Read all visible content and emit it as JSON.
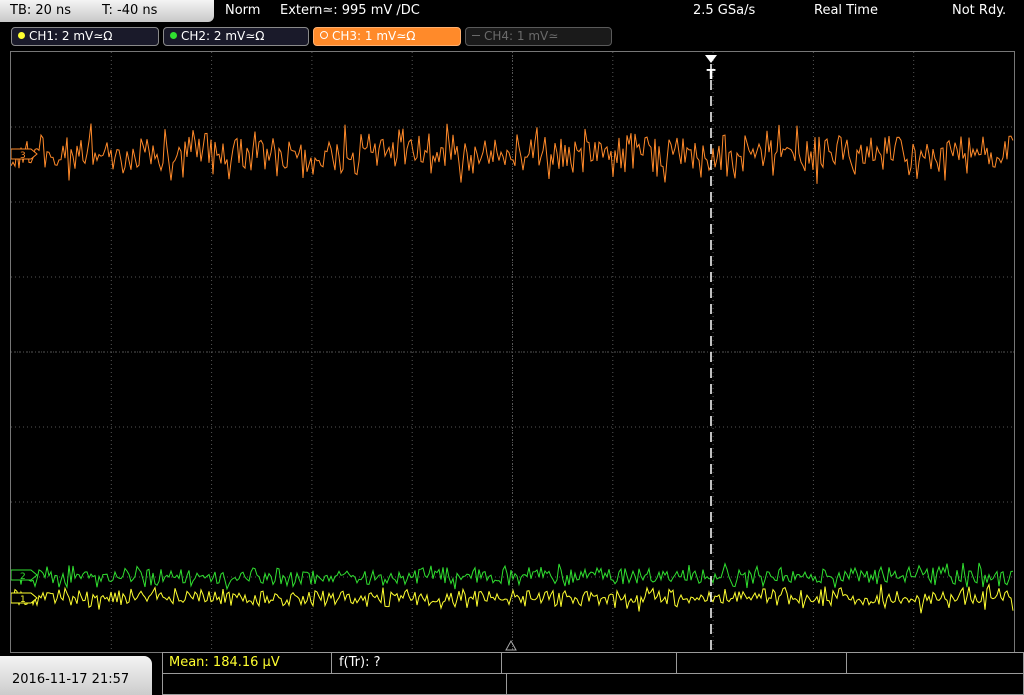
{
  "topbar": {
    "timebase": "TB: 20 ns",
    "trigger_offset": "T: -40 ns",
    "mode": "Norm",
    "trigger_source": "Extern≃: 995 mV ∕DC",
    "sample_rate": "2.5 GSa/s",
    "acq_mode": "Real Time",
    "status": "Not Rdy."
  },
  "channels": [
    {
      "label": "CH1: 2 mV≃Ω",
      "color": "#ffff30",
      "state": "on"
    },
    {
      "label": "CH2: 2 mV≃Ω",
      "color": "#30e030",
      "state": "on"
    },
    {
      "label": "CH3: 1 mV≃Ω",
      "color": "#ff8a2a",
      "state": "selected"
    },
    {
      "label": "CH4: 1 mV≃",
      "color": "#6a6a6a",
      "state": "off"
    }
  ],
  "markers": {
    "ch1": "1",
    "ch2": "2",
    "ch3": "3",
    "trigger": "T"
  },
  "bottom": {
    "datetime": "2016-11-17 21:57",
    "measurement_1": "Mean: 184.16 µV",
    "measurement_2": "f(Tr): ?"
  },
  "colors": {
    "ch1": "#ffff30",
    "ch2": "#30e030",
    "ch3": "#ff8a2a",
    "grid": "#555555",
    "trigger_line": "#ffffff"
  }
}
